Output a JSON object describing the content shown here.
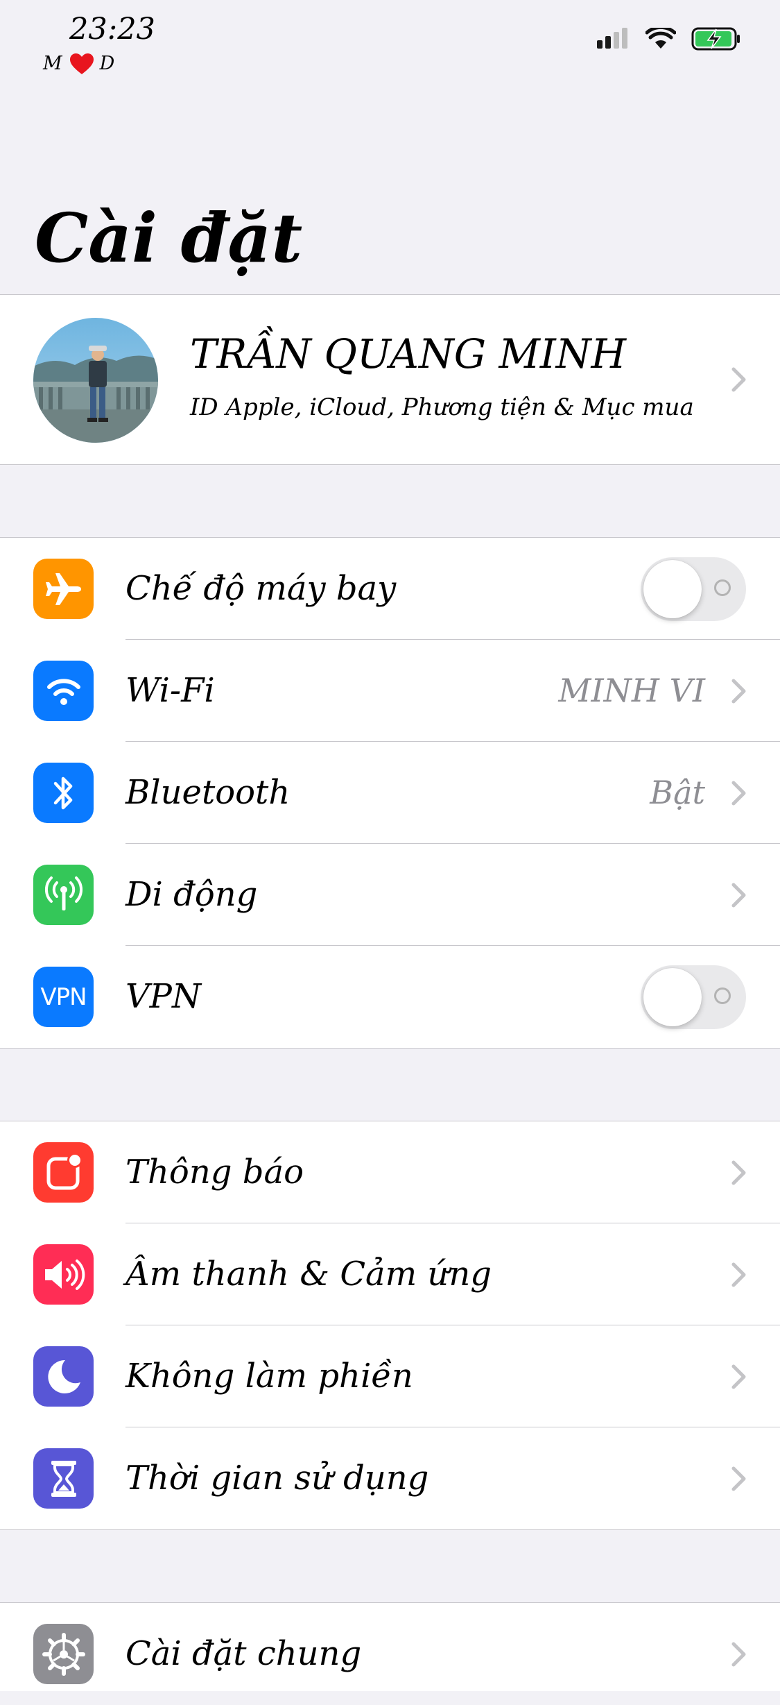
{
  "status": {
    "time": "23:23",
    "sub_left": "M",
    "sub_right": "D"
  },
  "page": {
    "title": "Cài đặt"
  },
  "profile": {
    "name": "TRẦN QUANG MINH",
    "subtitle": "ID Apple, iCloud, Phương tiện & Mục mua"
  },
  "connectivity": {
    "airplane": {
      "label": "Chế độ máy bay",
      "icon": "airplane-icon",
      "color": "#FF9500",
      "on": false
    },
    "wifi": {
      "label": "Wi-Fi",
      "value": "MINH VI",
      "icon": "wifi-icon",
      "color": "#0A7AFF"
    },
    "bluetooth": {
      "label": "Bluetooth",
      "value": "Bật",
      "icon": "bluetooth-icon",
      "color": "#0A7AFF"
    },
    "cellular": {
      "label": "Di động",
      "icon": "cellular-antenna-icon",
      "color": "#34C759"
    },
    "vpn": {
      "label": "VPN",
      "icon_text": "VPN",
      "color": "#0A7AFF",
      "on": false
    }
  },
  "notifications_group": {
    "notifications": {
      "label": "Thông báo",
      "icon": "notifications-icon",
      "color": "#FF3B30"
    },
    "sounds": {
      "label": "Âm thanh & Cảm ứng",
      "icon": "speaker-icon",
      "color": "#FF2D55"
    },
    "dnd": {
      "label": "Không làm phiền",
      "icon": "moon-icon",
      "color": "#5856D6"
    },
    "screen_time": {
      "label": "Thời gian sử dụng",
      "icon": "hourglass-icon",
      "color": "#5856D6"
    }
  },
  "general_group": {
    "general": {
      "label": "Cài đặt chung",
      "icon": "gear-icon",
      "color": "#8E8E93"
    }
  }
}
